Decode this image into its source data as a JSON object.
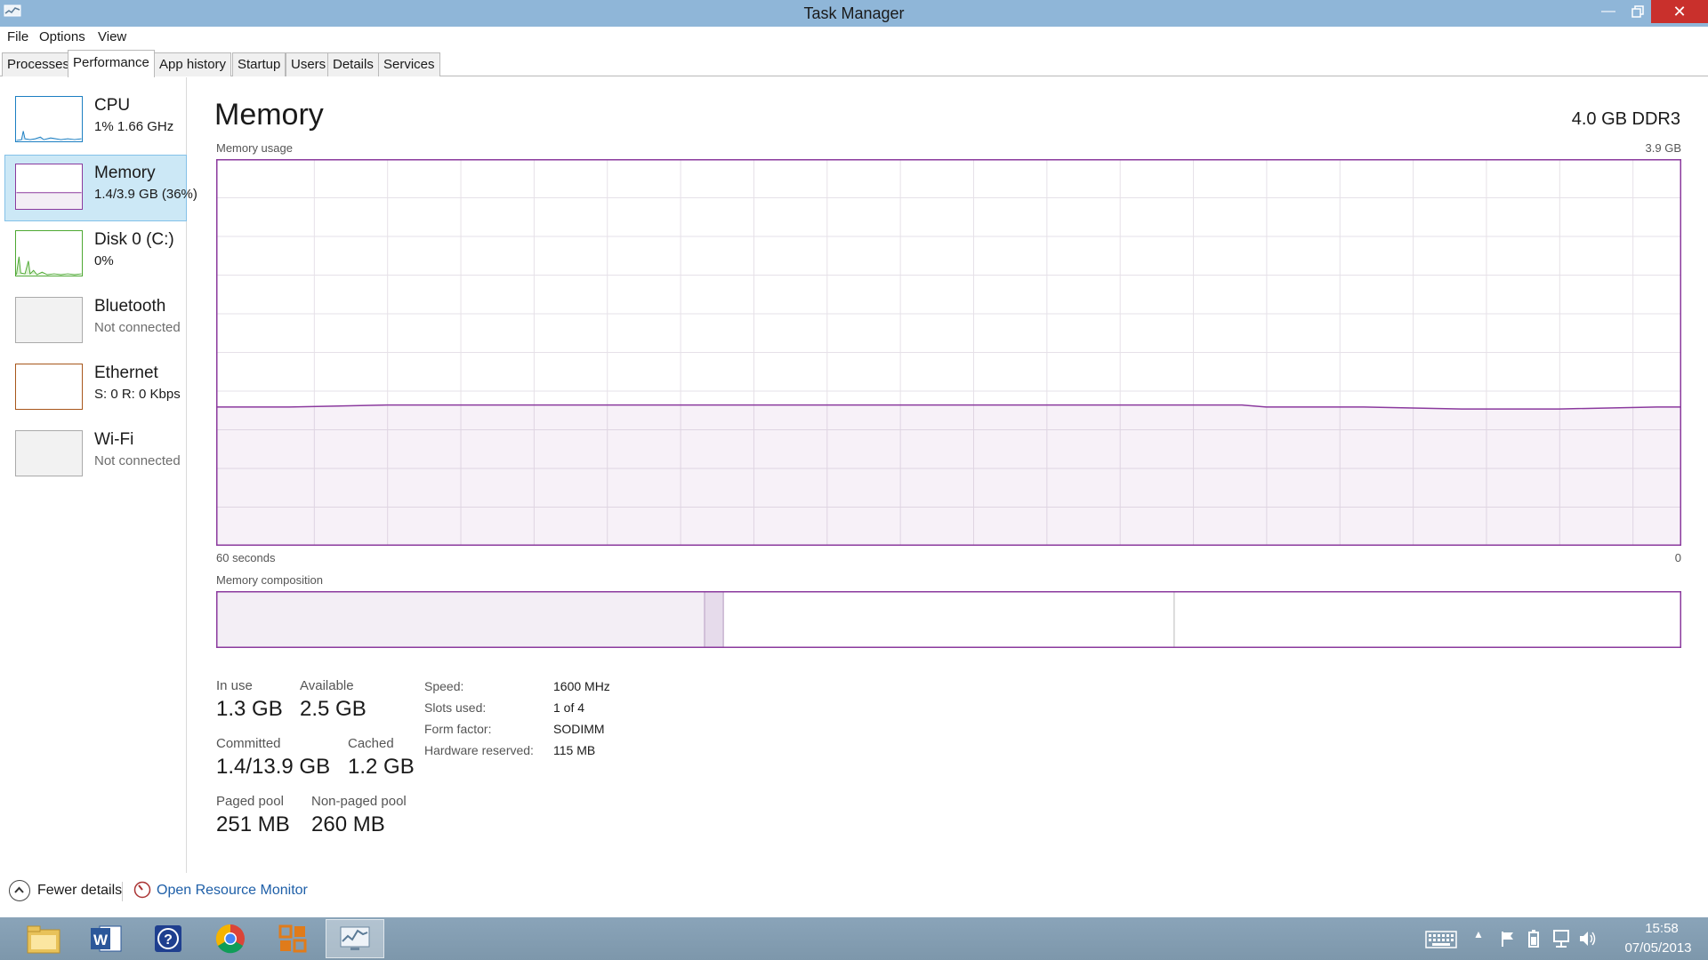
{
  "window": {
    "title": "Task Manager",
    "minimize_icon": "minimize-icon",
    "maximize_icon": "restore-icon",
    "close_icon": "close-icon"
  },
  "menu": [
    "File",
    "Options",
    "View"
  ],
  "tabs": [
    {
      "label": "Processes",
      "active": false
    },
    {
      "label": "Performance",
      "active": true
    },
    {
      "label": "App history",
      "active": false
    },
    {
      "label": "Startup",
      "active": false
    },
    {
      "label": "Users",
      "active": false
    },
    {
      "label": "Details",
      "active": false
    },
    {
      "label": "Services",
      "active": false
    }
  ],
  "devices": [
    {
      "name": "CPU",
      "sub": "1%  1.66 GHz",
      "muted": false,
      "color": "#1c7fc2"
    },
    {
      "name": "Memory",
      "sub": "1.4/3.9 GB (36%)",
      "muted": false,
      "color": "#8b3a9e",
      "selected": true
    },
    {
      "name": "Disk 0 (C:)",
      "sub": "0%",
      "muted": false,
      "color": "#4da832"
    },
    {
      "name": "Bluetooth",
      "sub": "Not connected",
      "muted": true,
      "color": "#aaaaaa"
    },
    {
      "name": "Ethernet",
      "sub": "S: 0  R: 0 Kbps",
      "muted": false,
      "color": "#a7561b"
    },
    {
      "name": "Wi-Fi",
      "sub": "Not connected",
      "muted": true,
      "color": "#aaaaaa"
    }
  ],
  "main": {
    "title": "Memory",
    "spec": "4.0 GB DDR3",
    "usage_label": "Memory usage",
    "usage_max": "3.9 GB",
    "time_span": "60 seconds",
    "time_zero": "0",
    "composition_label": "Memory composition"
  },
  "chart_data": {
    "type": "area",
    "ylim": [
      0,
      3.9
    ],
    "ylabel": "",
    "xlabel": "",
    "x": [
      60,
      57,
      53,
      49,
      45,
      41,
      37,
      33,
      29,
      25,
      21,
      18,
      17,
      13,
      9,
      5,
      1,
      0
    ],
    "values": [
      1.4,
      1.4,
      1.42,
      1.42,
      1.42,
      1.42,
      1.42,
      1.42,
      1.42,
      1.42,
      1.42,
      1.42,
      1.4,
      1.4,
      1.38,
      1.38,
      1.4,
      1.4
    ],
    "grid": true,
    "color": "#8b3a9e",
    "composition": {
      "in_use": 1.3,
      "modified": 0.05,
      "standby": 1.2,
      "free": 1.35
    }
  },
  "stats": {
    "in_use_label": "In use",
    "in_use": "1.3 GB",
    "available_label": "Available",
    "available": "2.5 GB",
    "committed_label": "Committed",
    "committed": "1.4/13.9 GB",
    "cached_label": "Cached",
    "cached": "1.2 GB",
    "paged_label": "Paged pool",
    "paged": "251 MB",
    "nonpaged_label": "Non-paged pool",
    "nonpaged": "260 MB"
  },
  "specs": [
    {
      "label": "Speed:",
      "value": "1600 MHz"
    },
    {
      "label": "Slots used:",
      "value": "1 of 4"
    },
    {
      "label": "Form factor:",
      "value": "SODIMM"
    },
    {
      "label": "Hardware reserved:",
      "value": "115 MB"
    }
  ],
  "footer": {
    "fewer_details": "Fewer details",
    "open_resource_monitor": "Open Resource Monitor"
  },
  "taskbar": {
    "apps": [
      "file-explorer-icon",
      "word-icon",
      "help-icon",
      "chrome-icon",
      "app-icon",
      "task-manager-icon"
    ],
    "time": "15:58",
    "date": "07/05/2013"
  }
}
